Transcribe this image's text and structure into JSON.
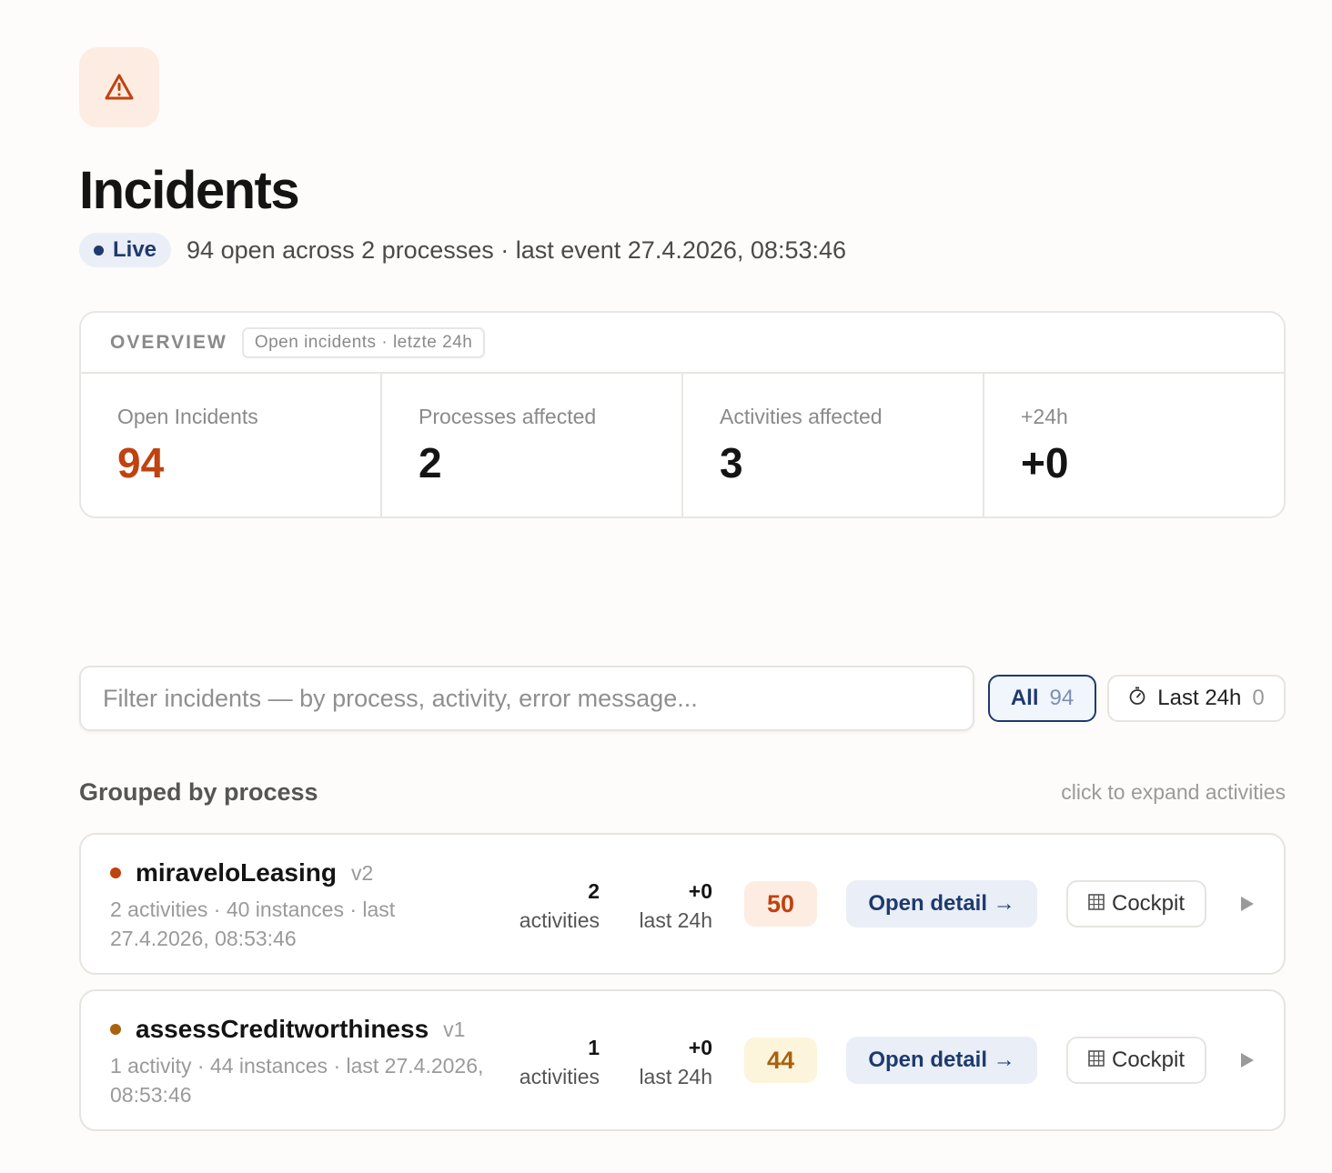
{
  "header": {
    "icon": "warning-triangle-icon",
    "title": "Incidents",
    "live_label": "Live",
    "subline": "94 open across 2 processes · last event 27.4.2026, 08:53:46"
  },
  "overview": {
    "label": "OVERVIEW",
    "tag": "Open incidents · letzte 24h",
    "stats": [
      {
        "label": "Open Incidents",
        "value": "94"
      },
      {
        "label": "Processes affected",
        "value": "2"
      },
      {
        "label": "Activities affected",
        "value": "3"
      },
      {
        "label": "+24h",
        "value": "+0"
      }
    ]
  },
  "filter": {
    "placeholder": "Filter incidents — by process, activity, error message...",
    "value": "",
    "chips": [
      {
        "label": "All",
        "count": "94",
        "selected": true
      },
      {
        "label": "Last 24h",
        "count": "0",
        "icon": "stopwatch-icon",
        "selected": false
      }
    ]
  },
  "groups": {
    "title": "Grouped by process",
    "hint": "click to expand activities",
    "processes": [
      {
        "name": "miraveloLeasing",
        "version": "v2",
        "meta": "2 activities · 40 instances · last 27.4.2026, 08:53:46",
        "activities_num": "2",
        "activities_label": "activities",
        "last24_num": "+0",
        "last24_label": "last 24h",
        "count": "50",
        "open_detail": "Open detail →",
        "cockpit": "Cockpit",
        "dot_color": "#c0420f",
        "badge_bg": "#fdece2",
        "badge_fg": "#c0420f"
      },
      {
        "name": "assessCreditworthiness",
        "version": "v1",
        "meta": "1 activity · 44 instances · last 27.4.2026, 08:53:46",
        "activities_num": "1",
        "activities_label": "activities",
        "last24_num": "+0",
        "last24_label": "last 24h",
        "count": "44",
        "open_detail": "Open detail →",
        "cockpit": "Cockpit",
        "dot_color": "#a9620e",
        "badge_bg": "#fdf4dc",
        "badge_fg": "#a9620e"
      }
    ]
  },
  "colors": {
    "accent": "#c0420f",
    "brand_navy": "#1e3a6e",
    "live_bg": "#e9eef7"
  }
}
